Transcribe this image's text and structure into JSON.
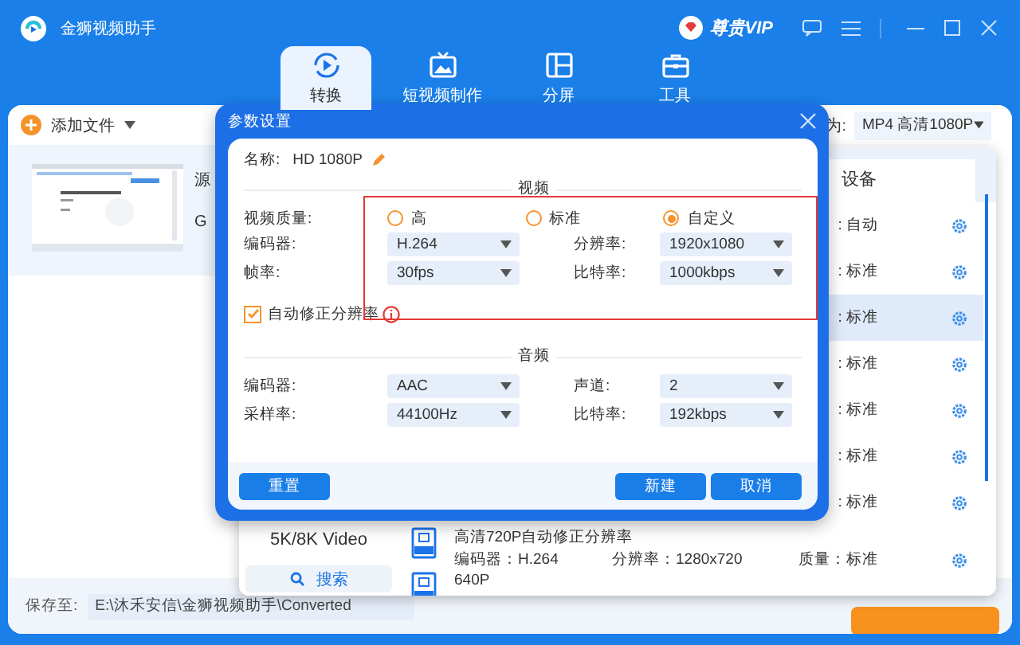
{
  "app": {
    "title": "金狮视频助手",
    "vip": "尊贵VIP"
  },
  "tabs": [
    {
      "label": "转换",
      "selected": true
    },
    {
      "label": "短视频制作",
      "selected": false
    },
    {
      "label": "分屏",
      "selected": false
    },
    {
      "label": "工具",
      "selected": false
    }
  ],
  "toolbar": {
    "add_files": "添加文件",
    "output_label": "为:",
    "output_format": "MP4 高清1080P"
  },
  "file": {
    "fragments": [
      "源",
      "G"
    ]
  },
  "format_popup": {
    "tab": "设备",
    "category": "5K/8K Video",
    "search": "搜索",
    "rows": [
      {
        "quality": ": 自动",
        "selected": false
      },
      {
        "quality": ": 标准",
        "selected": false
      },
      {
        "quality": ": 标准",
        "selected": true
      },
      {
        "quality": ": 标准",
        "selected": false
      },
      {
        "quality": ": 标准",
        "selected": false
      },
      {
        "quality": ": 标准",
        "selected": false
      },
      {
        "quality": ": 标准",
        "selected": false
      },
      {
        "title": "高清720P自动修正分辨率",
        "encoder": "编码器：H.264",
        "resolution": "分辨率：1280x720",
        "quality": "质量：标准",
        "selected": false
      },
      {
        "title": "640P",
        "selected": false
      }
    ]
  },
  "dialog": {
    "title": "参数设置",
    "name_label": "名称:",
    "name": "HD 1080P",
    "video_heading": "视频",
    "quality_label": "视频质量:",
    "quality_options": [
      {
        "label": "高",
        "selected": false
      },
      {
        "label": "标准",
        "selected": false
      },
      {
        "label": "自定义",
        "selected": true
      }
    ],
    "video_fields": [
      {
        "label": "编码器:",
        "value": "H.264"
      },
      {
        "label": "分辨率:",
        "value": "1920x1080"
      },
      {
        "label": "帧率:",
        "value": "30fps"
      },
      {
        "label": "比特率:",
        "value": "1000kbps"
      }
    ],
    "auto_fix": {
      "label": "自动修正分辨率",
      "checked": true
    },
    "audio_heading": "音频",
    "audio_fields": [
      {
        "label": "编码器:",
        "value": "AAC"
      },
      {
        "label": "声道:",
        "value": "2"
      },
      {
        "label": "采样率:",
        "value": "44100Hz"
      },
      {
        "label": "比特率:",
        "value": "192kbps"
      }
    ],
    "buttons": {
      "reset": "重置",
      "create": "新建",
      "cancel": "取消"
    }
  },
  "save": {
    "label": "保存至:",
    "path": "E:\\沐禾安信\\金狮视频助手\\Converted"
  }
}
